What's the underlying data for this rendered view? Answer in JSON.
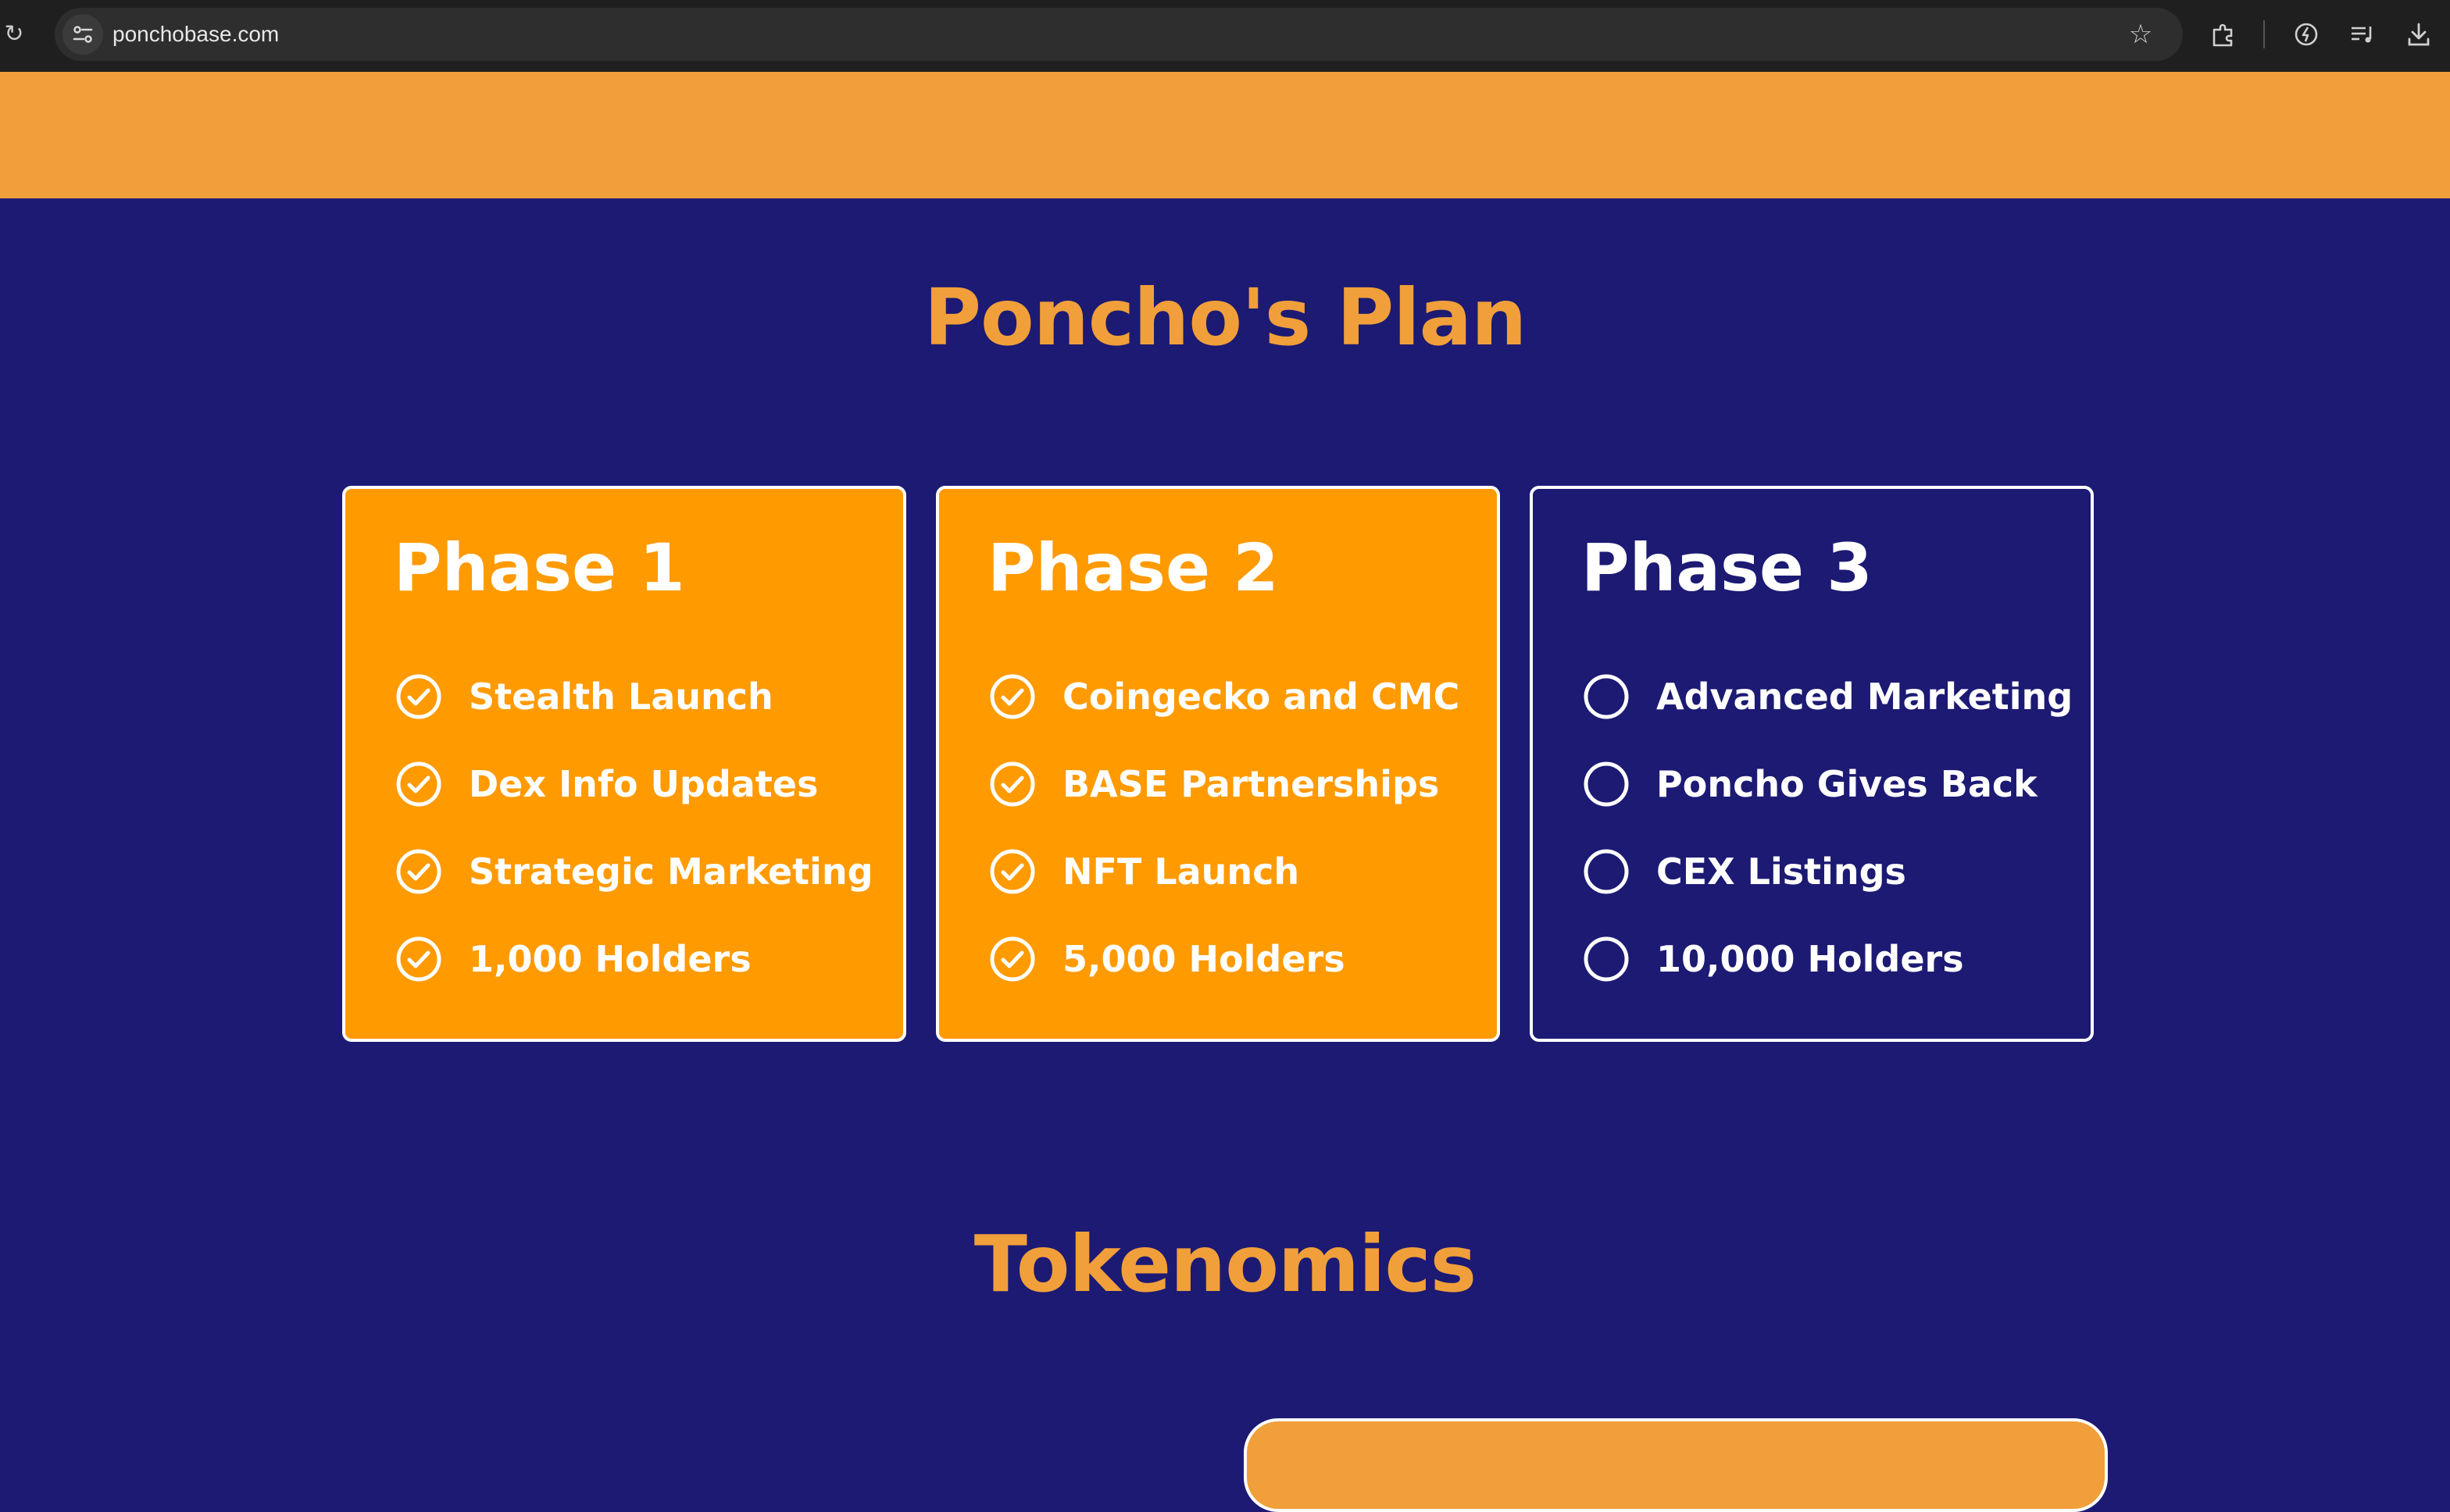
{
  "browser": {
    "url": "ponchobase.com",
    "icons": [
      "reload-icon",
      "site-info-icon",
      "bookmark-star-icon",
      "extensions-icon",
      "performance-icon",
      "media-controls-icon",
      "download-icon"
    ]
  },
  "colors": {
    "navy": "#1c1a73",
    "orange": "#f09f3a",
    "card_orange": "#ff9a00",
    "white": "#ffffff"
  },
  "plan": {
    "title": "Poncho's Plan",
    "phases": [
      {
        "title": "Phase 1",
        "status": "completed",
        "items": [
          "Stealth Launch",
          "Dex Info Updates",
          "Strategic Marketing",
          "1,000 Holders"
        ]
      },
      {
        "title": "Phase 2",
        "status": "completed",
        "items": [
          "Coingecko and CMC",
          "BASE Partnerships",
          "NFT Launch",
          "5,000 Holders"
        ]
      },
      {
        "title": "Phase 3",
        "status": "upcoming",
        "items": [
          "Advanced Marketing",
          "Poncho Gives Back",
          "CEX Listings",
          "10,000 Holders"
        ]
      }
    ]
  },
  "tokenomics": {
    "title": "Tokenomics"
  }
}
